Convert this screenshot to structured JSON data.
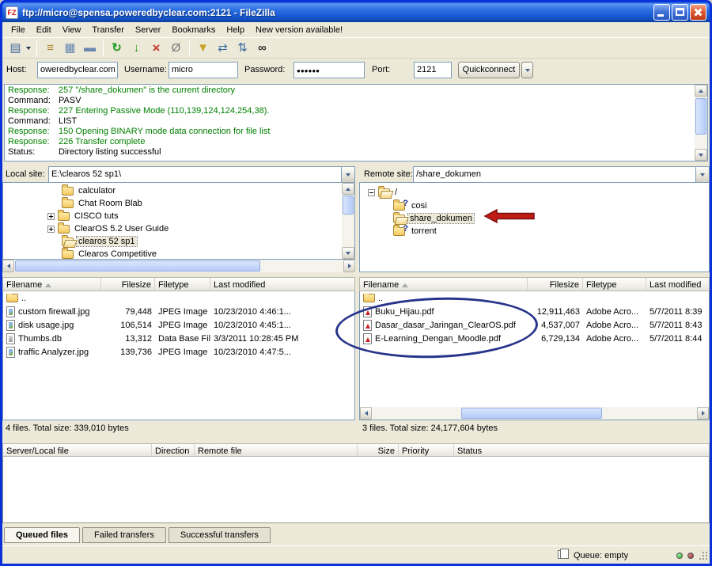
{
  "window": {
    "title": "ftp://micro@spensa.poweredbyclear.com:2121 - FileZilla",
    "logo_text": "FZ"
  },
  "menu": {
    "items": [
      "File",
      "Edit",
      "View",
      "Transfer",
      "Server",
      "Bookmarks",
      "Help",
      "New version available!"
    ]
  },
  "toolbar": {
    "icons": [
      {
        "name": "site-manager",
        "glyph": "▤"
      },
      {
        "name": "toggle-message-log",
        "glyph": "≡"
      },
      {
        "name": "toggle-tree-views",
        "glyph": "▦"
      },
      {
        "name": "toggle-transfer-queue",
        "glyph": "▬"
      },
      {
        "name": "refresh",
        "glyph": "↻"
      },
      {
        "name": "process-queue",
        "glyph": "↓"
      },
      {
        "name": "cancel-operation",
        "glyph": "×"
      },
      {
        "name": "disconnect",
        "glyph": "Ø"
      },
      {
        "name": "filename-filters",
        "glyph": "▼"
      },
      {
        "name": "directory-comparison",
        "glyph": "⇄"
      },
      {
        "name": "synchronized-browsing",
        "glyph": "⇅"
      },
      {
        "name": "find-files",
        "glyph": "∞"
      }
    ]
  },
  "icons": {
    "question_mark": "?"
  },
  "quickconnect": {
    "host_label": "Host:",
    "host_value": "oweredbyclear.com",
    "username_label": "Username:",
    "username_value": "micro",
    "password_label": "Password:",
    "password_value": "●●●●●●",
    "port_label": "Port:",
    "port_value": "2121",
    "button_label": "Quickconnect"
  },
  "log": {
    "lines": [
      {
        "kind": "response",
        "label": "Response:",
        "text": "257 \"/share_dokumen\" is the current directory"
      },
      {
        "kind": "command",
        "label": "Command:",
        "text": "PASV"
      },
      {
        "kind": "response",
        "label": "Response:",
        "text": "227 Entering Passive Mode (110,139,124,124,254,38)."
      },
      {
        "kind": "command",
        "label": "Command:",
        "text": "LIST"
      },
      {
        "kind": "response",
        "label": "Response:",
        "text": "150 Opening BINARY mode data connection for file list"
      },
      {
        "kind": "response",
        "label": "Response:",
        "text": "226 Transfer complete"
      },
      {
        "kind": "status",
        "label": "Status:",
        "text": "Directory listing successful"
      }
    ]
  },
  "local_panel": {
    "label": "Local site:",
    "path": "E:\\clearos 52 sp1\\",
    "tree": [
      {
        "label": "calculator"
      },
      {
        "label": "Chat Room Blab"
      },
      {
        "label": "CISCO tuts"
      },
      {
        "label": "ClearOS 5.2 User Guide"
      },
      {
        "label": "clearos 52 sp1"
      },
      {
        "label": "Clearos Competitive"
      }
    ]
  },
  "remote_panel": {
    "label": "Remote site:",
    "path": "/share_dokumen",
    "tree": [
      {
        "label": "/"
      },
      {
        "label": "cosi"
      },
      {
        "label": "share_dokumen"
      },
      {
        "label": "torrent"
      }
    ]
  },
  "local_list": {
    "columns": [
      "Filename",
      "Filesize",
      "Filetype",
      "Last modified"
    ],
    "rows": [
      {
        "name": "..",
        "size": "",
        "type": "",
        "modified": ""
      },
      {
        "name": "custom firewall.jpg",
        "size": "79,448",
        "type": "JPEG Image",
        "modified": "10/23/2010 4:46:1..."
      },
      {
        "name": "disk usage.jpg",
        "size": "106,514",
        "type": "JPEG Image",
        "modified": "10/23/2010 4:45:1..."
      },
      {
        "name": "Thumbs.db",
        "size": "13,312",
        "type": "Data Base File",
        "modified": "3/3/2011 10:28:45 PM"
      },
      {
        "name": "traffic Analyzer.jpg",
        "size": "139,736",
        "type": "JPEG Image",
        "modified": "10/23/2010 4:47:5..."
      }
    ],
    "status": "4 files. Total size: 339,010 bytes"
  },
  "remote_list": {
    "columns": [
      "Filename",
      "Filesize",
      "Filetype",
      "Last modified"
    ],
    "rows": [
      {
        "name": "..",
        "size": "",
        "type": "",
        "modified": ""
      },
      {
        "name": "Buku_Hijau.pdf",
        "size": "12,911,463",
        "type": "Adobe Acro...",
        "modified": "5/7/2011 8:39"
      },
      {
        "name": "Dasar_dasar_Jaringan_ClearOS.pdf",
        "size": "4,537,007",
        "type": "Adobe Acro...",
        "modified": "5/7/2011 8:43"
      },
      {
        "name": "E-Learning_Dengan_Moodle.pdf",
        "size": "6,729,134",
        "type": "Adobe Acro...",
        "modified": "5/7/2011 8:44"
      }
    ],
    "status": "3 files. Total size: 24,177,604 bytes"
  },
  "queue": {
    "columns": [
      "Server/Local file",
      "Direction",
      "Remote file",
      "Size",
      "Priority",
      "Status"
    ]
  },
  "tabs": {
    "items": [
      "Queued files",
      "Failed transfers",
      "Successful transfers"
    ],
    "active": "Queued files"
  },
  "statusbar": {
    "queue_status": "Queue: empty"
  },
  "colors": {
    "response_green": "#008000",
    "annotation_red": "#C11B17",
    "annotation_blue": "#27348B"
  }
}
